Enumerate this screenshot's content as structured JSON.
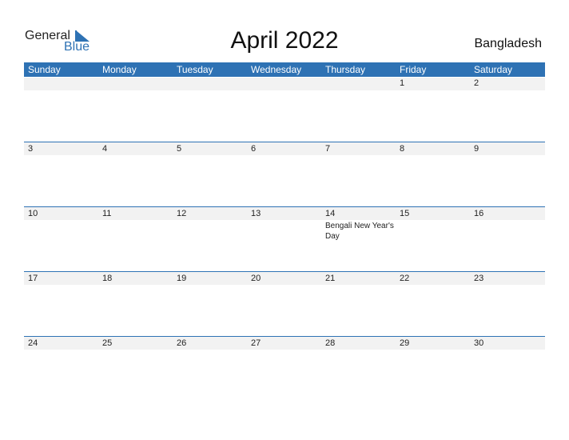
{
  "logo": {
    "general": "General",
    "blue": "Blue"
  },
  "title": "April 2022",
  "country": "Bangladesh",
  "weekdays": [
    "Sunday",
    "Monday",
    "Tuesday",
    "Wednesday",
    "Thursday",
    "Friday",
    "Saturday"
  ],
  "weeks": [
    [
      "",
      "",
      "",
      "",
      "",
      "1",
      "2"
    ],
    [
      "3",
      "4",
      "5",
      "6",
      "7",
      "8",
      "9"
    ],
    [
      "10",
      "11",
      "12",
      "13",
      "14",
      "15",
      "16"
    ],
    [
      "17",
      "18",
      "19",
      "20",
      "21",
      "22",
      "23"
    ],
    [
      "24",
      "25",
      "26",
      "27",
      "28",
      "29",
      "30"
    ]
  ],
  "events": [
    {
      "week": 2,
      "day": 4,
      "label": "Bengali New Year's Day"
    }
  ]
}
